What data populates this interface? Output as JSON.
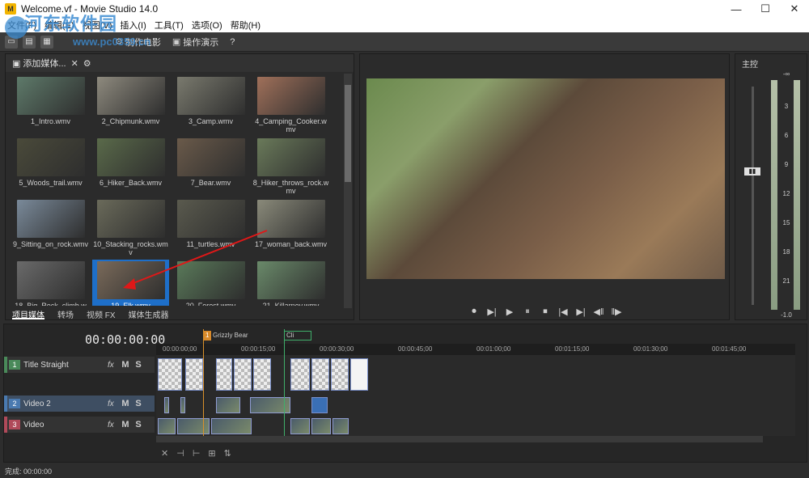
{
  "window": {
    "title": "Welcome.vf - Movie Studio 14.0",
    "app_icon": "M",
    "minimize": "—",
    "maximize": "☐",
    "close": "✕"
  },
  "watermark": {
    "text": "河东软件园",
    "url": "www.pc0359.cn"
  },
  "menu": [
    "文件(F)",
    "编辑(E)",
    "视图(V)",
    "插入(I)",
    "工具(T)",
    "选项(O)",
    "帮助(H)"
  ],
  "toolbar": {
    "make_movie": "制作电影",
    "demo": "操作演示",
    "help_icon": "?"
  },
  "media": {
    "add_media": "添加媒体...",
    "items": [
      {
        "name": "1_Intro.wmv",
        "selected": false,
        "color": "#5e7a6a"
      },
      {
        "name": "2_Chipmunk.wmv",
        "selected": false,
        "color": "#8e8a7e"
      },
      {
        "name": "3_Camp.wmv",
        "selected": false,
        "color": "#7a7a6e"
      },
      {
        "name": "4_Camping_Cooker.wmv",
        "selected": false,
        "color": "#a0705a"
      },
      {
        "name": "5_Woods_trail.wmv",
        "selected": false,
        "color": "#4a4a3a"
      },
      {
        "name": "6_Hiker_Back.wmv",
        "selected": false,
        "color": "#5a6a4a"
      },
      {
        "name": "7_Bear.wmv",
        "selected": false,
        "color": "#6a5a4a"
      },
      {
        "name": "8_Hiker_throws_rock.wmv",
        "selected": false,
        "color": "#6a7a5a"
      },
      {
        "name": "9_Sitting_on_rock.wmv",
        "selected": false,
        "color": "#7a8a9a"
      },
      {
        "name": "10_Stacking_rocks.wmv",
        "selected": false,
        "color": "#6a6a5a"
      },
      {
        "name": "11_turtles.wmv",
        "selected": false,
        "color": "#5a5a4e"
      },
      {
        "name": "17_woman_back.wmv",
        "selected": false,
        "color": "#8a8a7a"
      },
      {
        "name": "18_Big_Rock_climb.wmv",
        "selected": false,
        "color": "#6a6a6a"
      },
      {
        "name": "19_Elk.wmv",
        "selected": true,
        "color": "#7a6a5a"
      },
      {
        "name": "20_Forest.wmv",
        "selected": false,
        "color": "#5a7a5a"
      },
      {
        "name": "21_Killarney.wmv",
        "selected": false,
        "color": "#6a8a6a"
      }
    ],
    "tabs": [
      {
        "label": "项目媒体",
        "active": true
      },
      {
        "label": "转场",
        "active": false
      },
      {
        "label": "视频 FX",
        "active": false
      },
      {
        "label": "媒体生成器",
        "active": false
      }
    ]
  },
  "preview": {
    "controls": [
      "⏺",
      "▶|",
      "▶",
      "⏸",
      "⏹",
      "|◀",
      "▶|",
      "◀‖",
      "‖▶"
    ]
  },
  "master": {
    "title": "主控",
    "fader_label": "0.0",
    "scale": [
      "-∞",
      "3",
      "6",
      "9",
      "12",
      "15",
      "18",
      "21",
      "-1.0"
    ],
    "scale_left_bottom": "-1.0"
  },
  "timeline": {
    "timecode": "00:00:00:00",
    "markers": [
      {
        "num": "1",
        "label": "Grizzly Bear"
      },
      {
        "num": "",
        "label": "Cli"
      }
    ],
    "ruler": [
      "00:00:00;00",
      "00:00:15;00",
      "00:00:30;00",
      "00:00:45;00",
      "00:01:00;00",
      "00:01:15;00",
      "00:01:30;00",
      "00:01:45;00"
    ],
    "tracks": [
      {
        "num": "1",
        "name": "Title Straight",
        "color": "#4a8a5a",
        "selected": false
      },
      {
        "num": "2",
        "name": "Video 2",
        "color": "#4a7ab0",
        "selected": true
      },
      {
        "num": "3",
        "name": "Video",
        "color": "#b04a5a",
        "selected": false
      }
    ],
    "fx": "fx",
    "mute": "M",
    "solo": "S"
  },
  "status": "完成: 00:00:00"
}
